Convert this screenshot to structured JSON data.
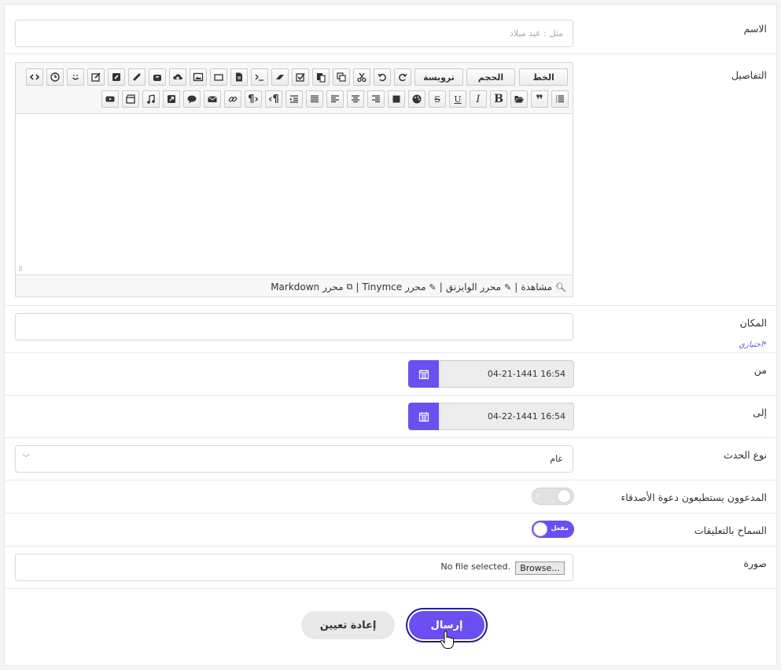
{
  "form": {
    "name": {
      "label": "الاسم",
      "placeholder": "مثل : عيد ميلاد"
    },
    "details": {
      "label": "التفاصيل",
      "toolbar_text": {
        "font": "الخط",
        "size": "الحجم",
        "heading": "ترويسة"
      },
      "footer": {
        "preview": "مشاهدة",
        "sep": "|",
        "wysiwyg": "محرر الوايزنق",
        "tinymce": "محرر Tinymce",
        "markdown": "محرر Markdown"
      }
    },
    "place": {
      "label": "المكان",
      "hint": "*اختياري"
    },
    "from": {
      "label": "من",
      "value": "04-21-1441 16:54"
    },
    "to": {
      "label": "إلى",
      "value": "04-22-1441 16:54"
    },
    "event_type": {
      "label": "نوع الحدث",
      "value": "عام"
    },
    "invite_friends": {
      "label": "المدعوون يستطيعون دعوة الأصدقاء",
      "toggle_text": "لا",
      "state": "off"
    },
    "allow_comments": {
      "label": "السماح بالتعليقات",
      "toggle_text": "مفعل",
      "state": "on"
    },
    "image": {
      "label": "صورة",
      "browse": "Browse...",
      "status": "No file selected."
    },
    "buttons": {
      "submit": "إرسال",
      "reset": "إعادة تعيين"
    }
  },
  "colors": {
    "accent": "#6b4ff0",
    "submit_ring": "#1f1f8a"
  }
}
